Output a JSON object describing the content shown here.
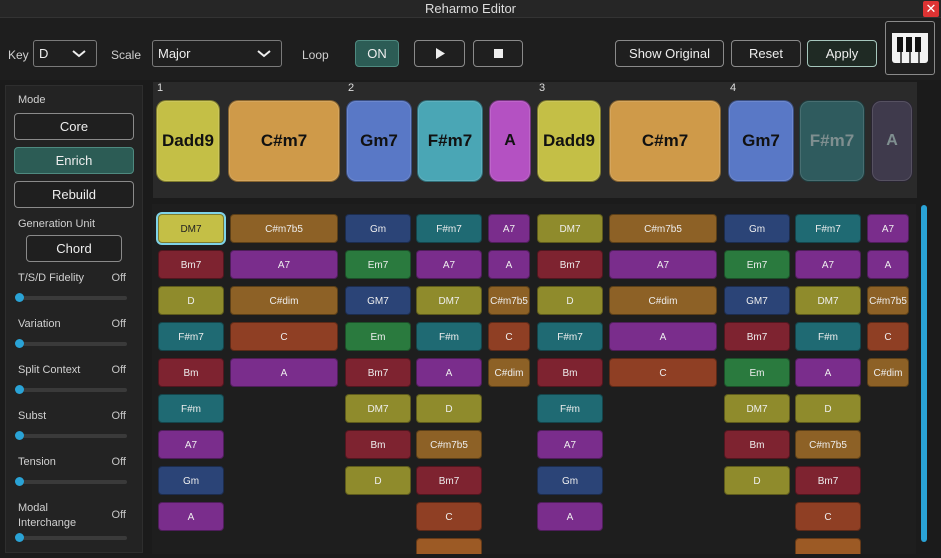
{
  "window": {
    "title": "Reharmo Editor"
  },
  "toolbar": {
    "key_label": "Key",
    "key_value": "D",
    "scale_label": "Scale",
    "scale_value": "Major",
    "loop_label": "Loop",
    "loop_value": "ON",
    "show_original": "Show Original",
    "reset": "Reset",
    "apply": "Apply"
  },
  "icons": {
    "close": "close-icon",
    "play": "play-icon",
    "stop": "stop-icon",
    "piano": "piano-icon",
    "dropdown": "chevron-down-icon"
  },
  "timeline": {
    "bars": [
      "1",
      "2",
      "3",
      "4"
    ],
    "chords": [
      {
        "label": "Dadd9",
        "color": "#c4bf46"
      },
      {
        "label": "C#m7",
        "color": "#cf9a49"
      },
      {
        "label": "Gm7",
        "color": "#5978c6"
      },
      {
        "label": "F#m7",
        "color": "#4aa6b5"
      },
      {
        "label": "A",
        "color": "#b451c2"
      },
      {
        "label": "Dadd9",
        "color": "#c4bf46"
      },
      {
        "label": "C#m7",
        "color": "#cf9a49"
      },
      {
        "label": "Gm7",
        "color": "#5978c6"
      },
      {
        "label": "F#m7",
        "color": "#2f5b5e"
      },
      {
        "label": "A",
        "color": "#3f3a4c"
      }
    ]
  },
  "sidebar": {
    "mode_label": "Mode",
    "modes": [
      "Core",
      "Enrich",
      "Rebuild"
    ],
    "generation_unit_label": "Generation Unit",
    "generation_unit_value": "Chord",
    "params": [
      {
        "label": "T/S/D Fidelity",
        "value": "Off",
        "level": 0
      },
      {
        "label": "Variation",
        "value": "Off",
        "level": 0
      },
      {
        "label": "Split Context",
        "value": "Off",
        "level": 0
      },
      {
        "label": "Subst",
        "value": "Off",
        "level": 0
      },
      {
        "label": "Tension",
        "value": "Off",
        "level": 0
      },
      {
        "label": "Modal",
        "label2": "Interchange",
        "value": "Off",
        "level": 0
      }
    ]
  },
  "candidates": {
    "colors": {
      "olive": "#8f8b2c",
      "amber": "#8d6126",
      "purple": "#7a2d8c",
      "navy": "#2b4477",
      "teal": "#1f6a73",
      "maroon": "#7e2330",
      "green": "#2a7a3e",
      "brown": "#8f3f24",
      "orange": "#9c5a25"
    },
    "columns": [
      [
        {
          "t": "DM7",
          "c": "olive",
          "sel": true
        },
        {
          "t": "Bm7",
          "c": "maroon"
        },
        {
          "t": "D",
          "c": "olive"
        },
        {
          "t": "F#m7",
          "c": "teal"
        },
        {
          "t": "Bm",
          "c": "maroon"
        },
        {
          "t": "F#m",
          "c": "teal"
        },
        {
          "t": "A7",
          "c": "purple"
        },
        {
          "t": "Gm",
          "c": "navy"
        },
        {
          "t": "A",
          "c": "purple"
        }
      ],
      [
        {
          "t": "C#m7b5",
          "c": "amber"
        },
        {
          "t": "A7",
          "c": "purple"
        },
        {
          "t": "C#dim",
          "c": "amber"
        },
        {
          "t": "C",
          "c": "brown"
        },
        {
          "t": "A",
          "c": "purple"
        }
      ],
      [
        {
          "t": "Gm",
          "c": "navy"
        },
        {
          "t": "Em7",
          "c": "green"
        },
        {
          "t": "GM7",
          "c": "navy"
        },
        {
          "t": "Em",
          "c": "green"
        },
        {
          "t": "Bm7",
          "c": "maroon"
        },
        {
          "t": "DM7",
          "c": "olive"
        },
        {
          "t": "Bm",
          "c": "maroon"
        },
        {
          "t": "D",
          "c": "olive"
        }
      ],
      [
        {
          "t": "F#m7",
          "c": "teal"
        },
        {
          "t": "A7",
          "c": "purple"
        },
        {
          "t": "DM7",
          "c": "olive"
        },
        {
          "t": "F#m",
          "c": "teal"
        },
        {
          "t": "A",
          "c": "purple"
        },
        {
          "t": "D",
          "c": "olive"
        },
        {
          "t": "C#m7b5",
          "c": "amber"
        },
        {
          "t": "Bm7",
          "c": "maroon"
        },
        {
          "t": "C",
          "c": "brown"
        },
        {
          "t": "",
          "c": "orange"
        }
      ],
      [
        {
          "t": "A7",
          "c": "purple"
        },
        {
          "t": "A",
          "c": "purple"
        },
        {
          "t": "C#m7b5",
          "c": "amber"
        },
        {
          "t": "C",
          "c": "brown"
        },
        {
          "t": "C#dim",
          "c": "amber"
        }
      ],
      [
        {
          "t": "DM7",
          "c": "olive"
        },
        {
          "t": "Bm7",
          "c": "maroon"
        },
        {
          "t": "D",
          "c": "olive"
        },
        {
          "t": "F#m7",
          "c": "teal"
        },
        {
          "t": "Bm",
          "c": "maroon"
        },
        {
          "t": "F#m",
          "c": "teal"
        },
        {
          "t": "A7",
          "c": "purple"
        },
        {
          "t": "Gm",
          "c": "navy"
        },
        {
          "t": "A",
          "c": "purple"
        }
      ],
      [
        {
          "t": "C#m7b5",
          "c": "amber"
        },
        {
          "t": "A7",
          "c": "purple"
        },
        {
          "t": "C#dim",
          "c": "amber"
        },
        {
          "t": "A",
          "c": "purple"
        },
        {
          "t": "C",
          "c": "brown"
        }
      ],
      [
        {
          "t": "Gm",
          "c": "navy"
        },
        {
          "t": "Em7",
          "c": "green"
        },
        {
          "t": "GM7",
          "c": "navy"
        },
        {
          "t": "Bm7",
          "c": "maroon"
        },
        {
          "t": "Em",
          "c": "green"
        },
        {
          "t": "DM7",
          "c": "olive"
        },
        {
          "t": "Bm",
          "c": "maroon"
        },
        {
          "t": "D",
          "c": "olive"
        }
      ],
      [
        {
          "t": "F#m7",
          "c": "teal"
        },
        {
          "t": "A7",
          "c": "purple"
        },
        {
          "t": "DM7",
          "c": "olive"
        },
        {
          "t": "F#m",
          "c": "teal"
        },
        {
          "t": "A",
          "c": "purple"
        },
        {
          "t": "D",
          "c": "olive"
        },
        {
          "t": "C#m7b5",
          "c": "amber"
        },
        {
          "t": "Bm7",
          "c": "maroon"
        },
        {
          "t": "C",
          "c": "brown"
        },
        {
          "t": "",
          "c": "orange"
        }
      ],
      [
        {
          "t": "A7",
          "c": "purple"
        },
        {
          "t": "A",
          "c": "purple"
        },
        {
          "t": "C#m7b5",
          "c": "amber"
        },
        {
          "t": "C",
          "c": "brown"
        },
        {
          "t": "C#dim",
          "c": "amber"
        }
      ]
    ]
  }
}
